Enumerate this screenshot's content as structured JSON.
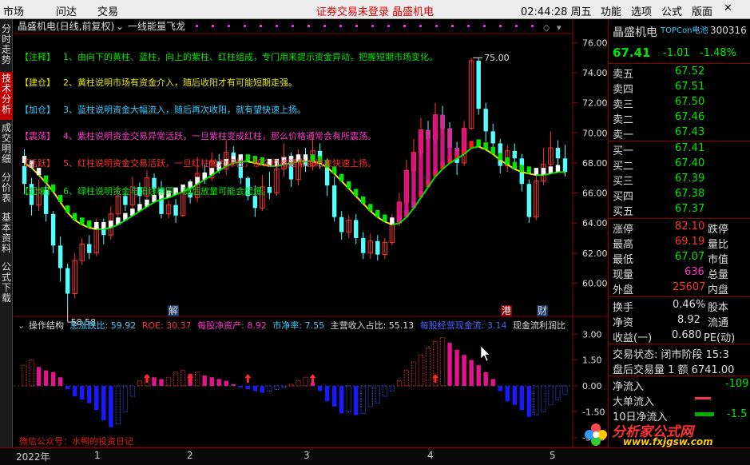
{
  "menubar": {
    "items": [
      "市场",
      "问达",
      "交易"
    ],
    "notice": "证券交易未登录  晶盛机电",
    "time": "02:44:28 周五",
    "right_items": [
      "功能",
      "选项",
      "公式",
      "版面"
    ],
    "close_glyph": "✕",
    "expand_glyph": "▾"
  },
  "sidebar": {
    "tabs": [
      "分时走势",
      "技术分析",
      "成交明细",
      "分价表",
      "基本资料",
      "公式下载"
    ],
    "active_index": 1
  },
  "main_chart": {
    "title": "晶盛机电(日线,前复权)",
    "indicator": "一线能量飞龙",
    "y_ticks": [
      "76.00",
      "74.00",
      "72.00",
      "70.00",
      "68.00",
      "66.00",
      "64.00",
      "62.00",
      "60.00"
    ],
    "high_label": "75.00",
    "low_label": "58.58",
    "notes": [
      {
        "tag": "【注释】",
        "text": "1、由向下的黄柱、蓝柱，向上的紫柱、红柱组成，专门用来提示资金异动，把握短期市场变化。",
        "color": "#00e600"
      },
      {
        "tag": "【建仓】",
        "text": "2、黄柱说明市场有资金介入，随后收阳才有可能短期走强。",
        "color": "#e6e600"
      },
      {
        "tag": "【加仓】",
        "text": "3、蓝柱说明资金大幅流入，随后再次收阳，就有望快速上扬。",
        "color": "#33ccff"
      },
      {
        "tag": "【震荡】",
        "text": "4、紫柱说明资金交易异常活跃，一旦紫柱变成红柱，那么价格通常会有所震荡。",
        "color": "#ff33cc"
      },
      {
        "tag": "【活跃】",
        "text": "5、红柱说明资金交易活跃，一旦红柱转为绿柱，那么价格通常会结束快速上扬。",
        "color": "#ff2a2a"
      },
      {
        "tag": "【起爆】",
        "text": "6、绿柱说明资金与阳线相同，随后放量可能会起爆。",
        "color": "#00e600"
      }
    ],
    "markers": {
      "jie": "解",
      "gang": "港",
      "cai": "财"
    }
  },
  "sub_chart": {
    "name": "操作结构",
    "stats": [
      {
        "label": "总涨跌比: ",
        "value": "59.92",
        "color": "#33ccff"
      },
      {
        "label": "ROE: ",
        "value": "30.37",
        "color": "#ff3333"
      },
      {
        "label": "每股净资产: ",
        "value": "8.92",
        "color": "#ff33cc"
      },
      {
        "label": "市净率: ",
        "value": "7.55",
        "color": "#33ccff"
      },
      {
        "label": "主营收入占比: ",
        "value": "55.13",
        "color": "#dddddd"
      },
      {
        "label": "每股经营现金流: ",
        "value": "3.14",
        "color": "#4466ff"
      },
      {
        "label": "现金流利润比",
        "value": "",
        "color": "#dddddd"
      }
    ],
    "y_ticks": [
      "3.00",
      "1.50",
      "0.00",
      "-1.50",
      "-3.00"
    ],
    "watermark": "微信公众号：水鸭的投资日记"
  },
  "x_axis": {
    "labels": [
      "2022年",
      "1",
      "2",
      "3",
      "4",
      "5"
    ]
  },
  "quote": {
    "name": "晶盛机电",
    "tag": "TOPCon电池",
    "code": "300316",
    "price": "67.41",
    "change": "-1.01",
    "change_pct": "-1.48%",
    "asks": [
      {
        "label": "卖五",
        "price": "67.52"
      },
      {
        "label": "卖四",
        "price": "67.51"
      },
      {
        "label": "卖三",
        "price": "67.50"
      },
      {
        "label": "卖二",
        "price": "67.46"
      },
      {
        "label": "卖一",
        "price": "67.43"
      }
    ],
    "bids": [
      {
        "label": "买一",
        "price": "67.41"
      },
      {
        "label": "买二",
        "price": "67.40"
      },
      {
        "label": "买三",
        "price": "67.39"
      },
      {
        "label": "买四",
        "price": "67.38"
      },
      {
        "label": "买五",
        "price": "67.37"
      }
    ],
    "stats": [
      {
        "label": "涨停",
        "value": "82.10",
        "color": "#ff3333",
        "right": "跌停"
      },
      {
        "label": "最高",
        "value": "69.19",
        "color": "#ff3333",
        "right": "量比"
      },
      {
        "label": "最低",
        "value": "67.07",
        "color": "#00e600",
        "right": "市值"
      },
      {
        "label": "现量",
        "value": "636",
        "color": "#ff33cc",
        "right": "总量"
      },
      {
        "label": "外盘",
        "value": "25607",
        "color": "#ff3333",
        "right": "内盘"
      }
    ],
    "stats2": [
      {
        "label": "换手",
        "value": "0.46%",
        "color": "#dddddd",
        "right": "股本"
      },
      {
        "label": "净资",
        "value": "8.92",
        "color": "#dddddd",
        "right": "流通"
      },
      {
        "label": "收益(一)",
        "value": "0.680",
        "color": "#dddddd",
        "right": "PE(动)"
      }
    ],
    "status_label": "交易状态: 闭市阶段 15:3",
    "after_hours": "盘后交易量 1 额 6741.00",
    "flows": [
      {
        "label": "净流入",
        "value": "-109",
        "color": "#00e600"
      },
      {
        "label": "大单流入",
        "value": "",
        "color": "#ff3333"
      },
      {
        "label": "10日净流入",
        "value": "-1.5",
        "color": "#00e600"
      }
    ]
  },
  "watermark_site": {
    "title": "分析家公式网",
    "url": "www.fxjgsw.com"
  },
  "chart_data": {
    "type": "candlestick",
    "x_labels": [
      "2022年",
      "1",
      "2",
      "3",
      "4",
      "5"
    ],
    "ylim": [
      58.0,
      76.5
    ],
    "annotations": {
      "high": 75.0,
      "low": 58.58
    },
    "candles": [
      [
        67.8,
        66.6,
        68.9,
        65.9
      ],
      [
        66.6,
        65.2,
        67.0,
        64.5
      ],
      [
        65.2,
        66.2,
        66.9,
        64.8
      ],
      [
        66.2,
        64.6,
        66.5,
        64.1
      ],
      [
        64.6,
        62.5,
        64.8,
        62.0
      ],
      [
        62.5,
        61.0,
        63.1,
        60.1
      ],
      [
        61.0,
        59.3,
        61.3,
        58.58
      ],
      [
        59.3,
        61.5,
        62.0,
        59.0
      ],
      [
        61.5,
        62.6,
        63.0,
        61.2
      ],
      [
        62.6,
        62.0,
        63.2,
        61.6
      ],
      [
        62.0,
        63.8,
        64.3,
        61.8
      ],
      [
        63.8,
        63.2,
        64.3,
        62.6
      ],
      [
        63.2,
        64.6,
        65.1,
        62.9
      ],
      [
        64.6,
        65.8,
        66.5,
        64.3
      ],
      [
        65.8,
        65.2,
        66.0,
        64.8
      ],
      [
        65.2,
        66.4,
        67.1,
        64.9
      ],
      [
        66.4,
        65.8,
        66.7,
        65.1
      ],
      [
        65.8,
        67.0,
        67.5,
        65.6
      ],
      [
        67.0,
        66.3,
        67.3,
        65.8
      ],
      [
        66.3,
        64.6,
        66.8,
        64.3
      ],
      [
        64.6,
        65.2,
        65.5,
        64.3
      ],
      [
        65.2,
        64.5,
        65.6,
        64.0
      ],
      [
        64.5,
        66.0,
        66.5,
        64.4
      ],
      [
        66.0,
        65.7,
        66.9,
        65.3
      ],
      [
        65.7,
        67.3,
        68.4,
        65.4
      ],
      [
        67.3,
        67.0,
        67.9,
        66.6
      ],
      [
        67.0,
        68.1,
        68.7,
        66.8
      ],
      [
        68.1,
        67.6,
        68.6,
        67.3
      ],
      [
        67.6,
        68.7,
        69.5,
        67.2
      ],
      [
        68.7,
        68.2,
        69.1,
        67.9
      ],
      [
        68.2,
        67.0,
        68.5,
        66.6
      ],
      [
        67.0,
        65.8,
        67.1,
        65.5
      ],
      [
        65.8,
        65.0,
        66.5,
        64.4
      ],
      [
        65.0,
        66.4,
        67.2,
        64.8
      ],
      [
        66.4,
        66.0,
        67.4,
        65.6
      ],
      [
        66.0,
        67.6,
        68.1,
        65.8
      ],
      [
        67.6,
        68.4,
        69.3,
        67.1
      ],
      [
        68.4,
        66.9,
        68.7,
        66.4
      ],
      [
        66.9,
        68.3,
        68.9,
        66.5
      ],
      [
        68.3,
        67.8,
        69.0,
        67.4
      ],
      [
        67.8,
        68.8,
        69.7,
        67.5
      ],
      [
        68.8,
        68.0,
        69.3,
        67.6
      ],
      [
        68.0,
        66.5,
        68.3,
        65.8
      ],
      [
        66.5,
        64.4,
        67.1,
        64.1
      ],
      [
        64.4,
        63.4,
        64.8,
        62.9
      ],
      [
        63.4,
        64.2,
        64.5,
        63.0
      ],
      [
        64.2,
        63.0,
        64.6,
        62.6
      ],
      [
        63.0,
        62.0,
        63.4,
        61.6
      ],
      [
        62.0,
        62.8,
        63.3,
        61.6
      ],
      [
        62.8,
        61.9,
        63.2,
        61.5
      ],
      [
        61.9,
        62.7,
        63.0,
        61.6
      ],
      [
        62.7,
        64.0,
        64.6,
        62.5
      ],
      [
        64.0,
        65.4,
        66.0,
        63.8
      ],
      [
        65.4,
        67.5,
        68.2,
        65.2
      ],
      [
        67.5,
        68.7,
        69.6,
        67.3
      ],
      [
        68.7,
        70.2,
        71.0,
        68.4
      ],
      [
        70.2,
        69.6,
        70.8,
        69.0
      ],
      [
        69.6,
        71.2,
        72.0,
        69.3
      ],
      [
        71.2,
        70.3,
        71.8,
        70.0
      ],
      [
        70.3,
        69.0,
        70.7,
        68.4
      ],
      [
        69.0,
        68.0,
        69.4,
        67.2
      ],
      [
        68.0,
        70.3,
        70.8,
        67.8
      ],
      [
        70.3,
        74.8,
        75.0,
        70.2
      ],
      [
        74.8,
        71.6,
        75.0,
        71.2
      ],
      [
        71.6,
        70.1,
        72.0,
        69.4
      ],
      [
        70.1,
        69.3,
        70.6,
        68.8
      ],
      [
        69.3,
        67.8,
        69.6,
        67.3
      ],
      [
        67.8,
        68.8,
        69.2,
        67.4
      ],
      [
        68.8,
        68.3,
        69.3,
        67.7
      ],
      [
        68.3,
        66.6,
        68.6,
        66.1
      ],
      [
        66.6,
        64.4,
        66.9,
        64.0
      ],
      [
        64.4,
        66.8,
        67.3,
        64.2
      ],
      [
        66.8,
        67.9,
        69.0,
        66.5
      ],
      [
        67.9,
        69.0,
        70.1,
        67.4
      ],
      [
        69.0,
        68.3,
        69.5,
        67.8
      ],
      [
        68.3,
        67.4,
        69.2,
        67.1
      ]
    ],
    "ma_line": [
      68.2,
      67.9,
      67.4,
      66.9,
      66.3,
      65.6,
      64.9,
      64.4,
      64.1,
      63.9,
      63.8,
      63.8,
      63.9,
      64.1,
      64.4,
      64.7,
      65.0,
      65.3,
      65.6,
      65.8,
      65.9,
      66.1,
      66.3,
      66.5,
      66.8,
      67.1,
      67.4,
      67.7,
      68.0,
      68.2,
      68.3,
      68.3,
      68.2,
      68.1,
      68.0,
      68.0,
      68.1,
      68.2,
      68.3,
      68.3,
      68.3,
      68.2,
      67.9,
      67.5,
      67.0,
      66.5,
      66.0,
      65.5,
      65.0,
      64.6,
      64.3,
      64.1,
      64.2,
      64.6,
      65.2,
      65.9,
      66.6,
      67.3,
      67.8,
      68.2,
      68.5,
      68.8,
      69.2,
      69.3,
      69.1,
      68.8,
      68.4,
      68.1,
      67.8,
      67.6,
      67.5,
      67.4,
      67.4,
      67.5,
      67.6,
      67.6
    ],
    "sub_series": [
      1.2,
      1.5,
      1.1,
      0.9,
      0.8,
      0.5,
      -0.2,
      -0.6,
      -0.8,
      -1.0,
      -1.4,
      -2.0,
      -2.4,
      -2.2,
      -1.5,
      -0.6,
      0.3,
      0.6,
      0.5,
      0.4,
      0.5,
      0.8,
      0.9,
      0.7,
      0.8,
      0.6,
      0.5,
      0.4,
      0.3,
      0.1,
      -0.1,
      -0.2,
      -0.3,
      -0.4,
      -0.3,
      -0.2,
      -0.1,
      0.1,
      0.3,
      0.5,
      0.2,
      -0.3,
      -0.9,
      -1.2,
      -1.6,
      -1.5,
      -1.7,
      -1.6,
      -1.2,
      -1.0,
      -0.6,
      -0.3,
      0.3,
      0.9,
      1.4,
      1.8,
      2.2,
      2.6,
      2.8,
      2.5,
      2.1,
      1.8,
      1.5,
      1.2,
      0.8,
      0.4,
      -0.3,
      -0.9,
      -1.1,
      -1.4,
      -1.8,
      -1.7,
      -1.5,
      -1.1,
      -0.8,
      -0.5
    ]
  }
}
